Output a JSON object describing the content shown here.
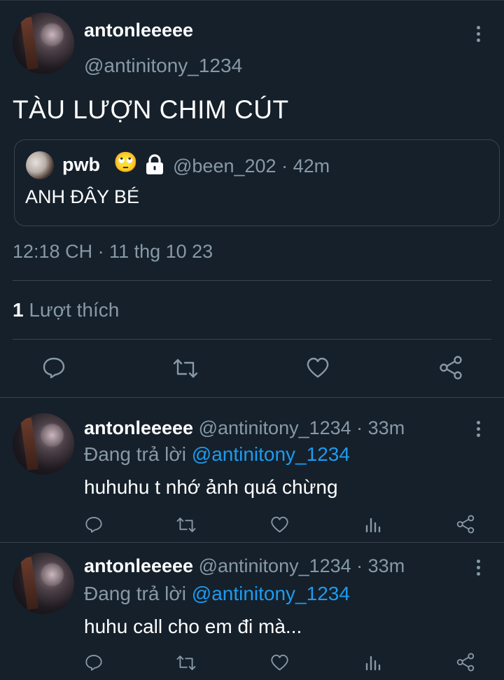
{
  "tweet": {
    "name": "antonleeeee",
    "handle": "@antinitony_1234",
    "text": "TÀU LƯỢN CHIM CÚT",
    "quote": {
      "name": "pwb",
      "emoji": "🙄",
      "handle": "@been_202",
      "sep": "·",
      "time": "42m",
      "text": "ANH ĐÂY BÉ"
    },
    "timestamp": "12:18 CH · 11 thg 10 23",
    "likes_count": "1",
    "likes_label": "Lượt thích"
  },
  "replies": [
    {
      "name": "antonleeeee",
      "handle_time": "@antinitony_1234 · 33m",
      "replying_label": "Đang trả lời",
      "replying_to": "@antinitony_1234",
      "text": "huhuhu t nhớ ảnh quá chừng"
    },
    {
      "name": "antonleeeee",
      "handle_time": "@antinitony_1234 · 33m",
      "replying_label": "Đang trả lời",
      "replying_to": "@antinitony_1234",
      "text": "huhu call cho em đi mà..."
    }
  ],
  "icons": [
    "more-vertical-icon",
    "lock-icon",
    "reply-icon",
    "retweet-icon",
    "like-icon",
    "share-icon",
    "views-icon"
  ],
  "colors": {
    "background": "#15202b",
    "muted": "#8899a6",
    "link": "#1d9bf0",
    "divider": "#38444d"
  }
}
